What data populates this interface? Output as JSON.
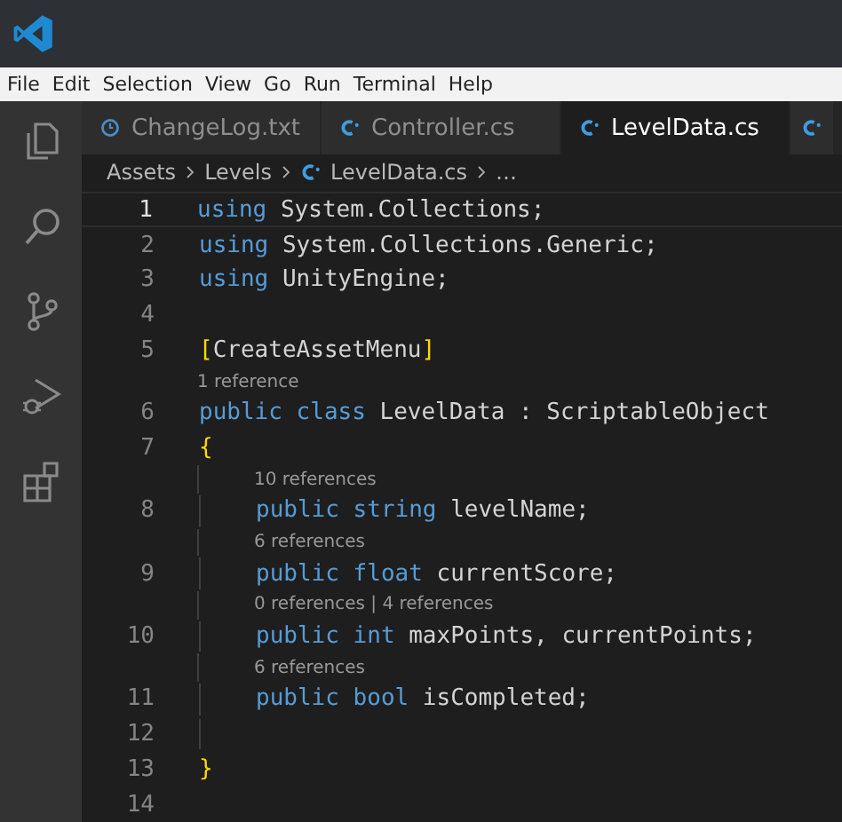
{
  "menu": [
    "File",
    "Edit",
    "Selection",
    "View",
    "Go",
    "Run",
    "Terminal",
    "Help"
  ],
  "activity_bar": [
    {
      "kind": "files"
    },
    {
      "kind": "search"
    },
    {
      "kind": "source-control"
    },
    {
      "kind": "run-debug"
    },
    {
      "kind": "extensions"
    }
  ],
  "tabs": [
    {
      "label": "ChangeLog.txt",
      "kind": "text-file",
      "selected": false
    },
    {
      "label": "Controller.cs",
      "kind": "csharp",
      "selected": false
    },
    {
      "label": "LevelData.cs",
      "kind": "csharp",
      "selected": true
    },
    {
      "kind": "csharp",
      "selected": false
    }
  ],
  "breadcrumb": [
    {
      "label": "Assets",
      "kind": "folder"
    },
    {
      "label": "Levels",
      "kind": "folder"
    },
    {
      "label": "LevelData.cs",
      "kind": "csharp"
    },
    {
      "label": "…",
      "kind": "more"
    }
  ],
  "lines": [
    {
      "number": "1",
      "current": true,
      "tokens": [
        {
          "kind": "keyword",
          "text": "using"
        },
        {
          "kind": "plain",
          "text": " System.Collections;"
        }
      ]
    },
    {
      "number": "2",
      "current": false,
      "tokens": [
        {
          "kind": "keyword",
          "text": "using"
        },
        {
          "kind": "plain",
          "text": " System.Collections.Generic;"
        }
      ]
    },
    {
      "number": "3",
      "current": false,
      "tokens": [
        {
          "kind": "keyword",
          "text": "using"
        },
        {
          "kind": "plain",
          "text": " UnityEngine;"
        }
      ]
    },
    {
      "number": "4",
      "current": false
    },
    {
      "number": "5",
      "current": false,
      "tokens": [
        {
          "kind": "bracket",
          "text": "["
        },
        {
          "kind": "plain",
          "text": "CreateAssetMenu"
        },
        {
          "kind": "bracket",
          "text": "]"
        }
      ]
    },
    {
      "number": "6",
      "current": false,
      "codelens": "1 reference",
      "tokens": [
        {
          "kind": "keyword",
          "text": "public class"
        },
        {
          "kind": "plain",
          "text": " LevelData : ScriptableObject"
        }
      ]
    },
    {
      "number": "7",
      "current": false,
      "tokens": [
        {
          "kind": "bracket",
          "text": "{"
        }
      ],
      "children": [
        {
          "number": "8",
          "current": false,
          "codelens": "10 references",
          "tokens": [
            {
              "kind": "keyword",
              "text": "public string"
            },
            {
              "kind": "plain",
              "text": " levelName;"
            }
          ]
        },
        {
          "number": "9",
          "current": false,
          "codelens": "6 references",
          "tokens": [
            {
              "kind": "keyword",
              "text": "public float"
            },
            {
              "kind": "plain",
              "text": " currentScore;"
            }
          ]
        },
        {
          "number": "10",
          "current": false,
          "codelens": "0 references | 4 references",
          "tokens": [
            {
              "kind": "keyword",
              "text": "public int"
            },
            {
              "kind": "plain",
              "text": " maxPoints, currentPoints;"
            }
          ]
        },
        {
          "number": "11",
          "current": false,
          "codelens": "6 references",
          "tokens": [
            {
              "kind": "keyword",
              "text": "public bool"
            },
            {
              "kind": "plain",
              "text": " isCompleted;"
            }
          ]
        },
        {
          "number": "12",
          "current": false
        }
      ]
    },
    {
      "number": "13",
      "current": false,
      "tokens": [
        {
          "kind": "bracket",
          "text": "}"
        }
      ]
    },
    {
      "number": "14",
      "current": false
    }
  ]
}
